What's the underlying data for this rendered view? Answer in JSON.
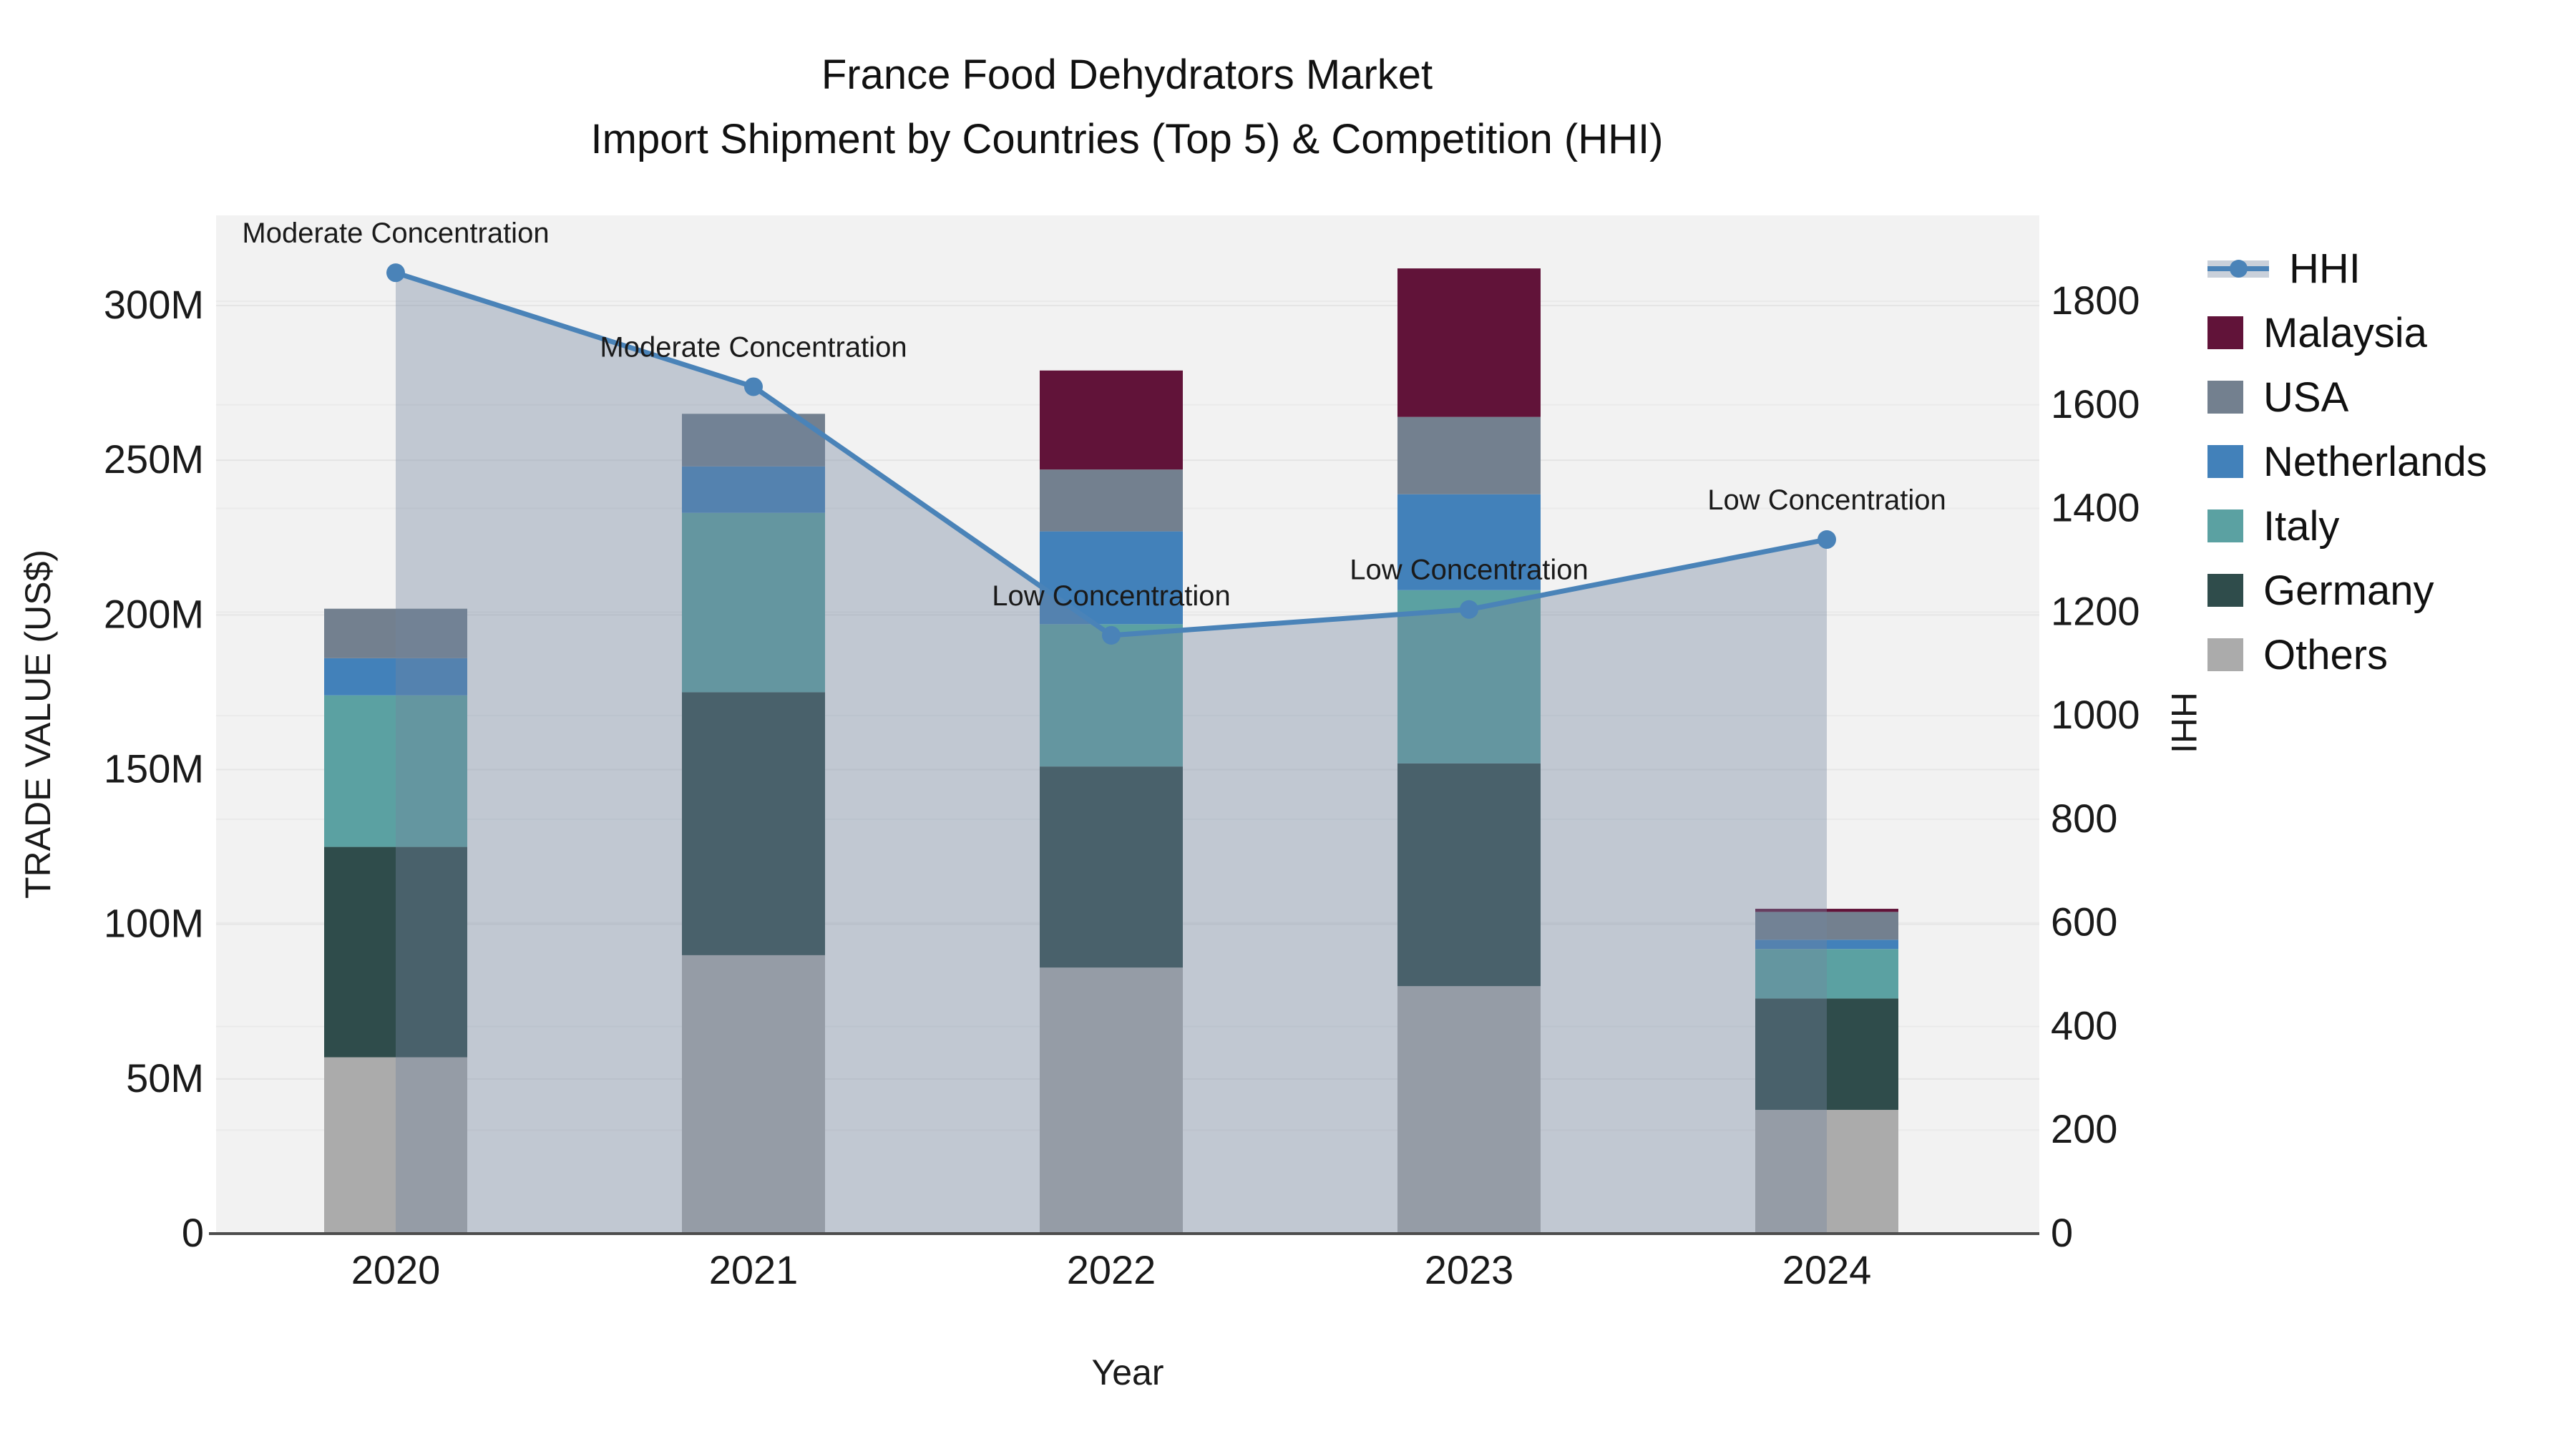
{
  "title": {
    "line1": "France Food Dehydrators Market",
    "line2": "Import Shipment by Countries (Top 5) & Competition (HHI)"
  },
  "chart_data": {
    "type": "combo-stacked-bar-line",
    "categories": [
      "2020",
      "2021",
      "2022",
      "2023",
      "2024"
    ],
    "xlabel": "Year",
    "bar_axis": {
      "label": "TRADE VALUE (US$)",
      "tick_labels": [
        "0",
        "50M",
        "100M",
        "150M",
        "200M",
        "250M",
        "300M"
      ],
      "tick_values": [
        0,
        50,
        100,
        150,
        200,
        250,
        300
      ],
      "units": "M US$",
      "ylim": [
        0,
        329
      ]
    },
    "line_axis": {
      "label": "HHI",
      "tick_labels": [
        "0",
        "200",
        "400",
        "600",
        "800",
        "1000",
        "1200",
        "1400",
        "1600",
        "1800"
      ],
      "tick_values": [
        0,
        200,
        400,
        600,
        800,
        1000,
        1200,
        1400,
        1600,
        1800
      ],
      "ylim": [
        0,
        1966
      ]
    },
    "series": [
      {
        "name": "Others",
        "color": "#ababab",
        "values": [
          57,
          90,
          86,
          80,
          40
        ]
      },
      {
        "name": "Germany",
        "color": "#2f4c4b",
        "values": [
          68,
          85,
          65,
          72,
          36
        ]
      },
      {
        "name": "Italy",
        "color": "#5ba1a2",
        "values": [
          49,
          58,
          46,
          56,
          16
        ]
      },
      {
        "name": "Netherlands",
        "color": "#4281ba",
        "values": [
          12,
          15,
          30,
          31,
          3
        ]
      },
      {
        "name": "USA",
        "color": "#73808f",
        "values": [
          16,
          17,
          20,
          25,
          9
        ]
      },
      {
        "name": "Malaysia",
        "color": "#611339",
        "values": [
          0,
          0,
          32,
          48,
          1
        ]
      }
    ],
    "line_series": {
      "name": "HHI",
      "color": "#4a83b8",
      "area_color": "#73859f",
      "area_opacity": 0.385,
      "values": [
        1855,
        1635,
        1155,
        1205,
        1340
      ]
    },
    "annotations": [
      {
        "category": "2020",
        "text": "Moderate Concentration"
      },
      {
        "category": "2021",
        "text": "Moderate Concentration"
      },
      {
        "category": "2022",
        "text": "Low Concentration"
      },
      {
        "category": "2023",
        "text": "Low Concentration"
      },
      {
        "category": "2024",
        "text": "Low Concentration"
      }
    ],
    "legend": [
      "HHI",
      "Malaysia",
      "USA",
      "Netherlands",
      "Italy",
      "Germany",
      "Others"
    ],
    "legend_position": "right",
    "grid": true,
    "plot_bg": "#f2f2f2",
    "grid_color": "#e5e5e5",
    "axis_line_color": "#4d4d4d",
    "text_color": "#1a1a1a"
  }
}
